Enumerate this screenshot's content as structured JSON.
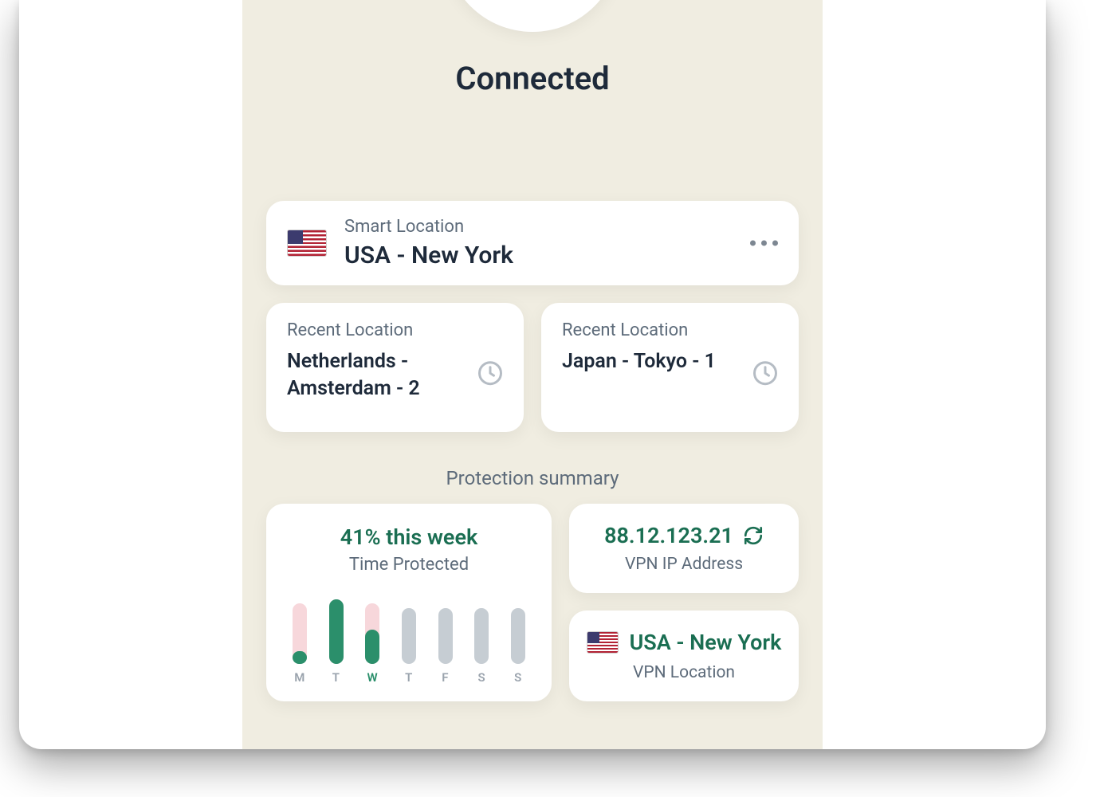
{
  "status": {
    "title": "Connected"
  },
  "smart_location": {
    "label": "Smart Location",
    "value": "USA - New York",
    "flag": "usa"
  },
  "recent": [
    {
      "label": "Recent Location",
      "value": "Netherlands - Amsterdam - 2"
    },
    {
      "label": "Recent Location",
      "value": "Japan - Tokyo - 1"
    }
  ],
  "protection": {
    "section_title": "Protection summary",
    "time": {
      "metric": "41% this week",
      "sub": "Time Protected"
    },
    "ip": {
      "value": "88.12.123.21",
      "label": "VPN IP Address"
    },
    "location": {
      "value": "USA - New York",
      "label": "VPN Location",
      "flag": "usa"
    }
  },
  "chart_data": {
    "type": "bar",
    "title": "Time Protected",
    "categories": [
      "M",
      "T",
      "W",
      "T",
      "F",
      "S",
      "S"
    ],
    "series": [
      {
        "name": "usage_background_pct",
        "values": [
          85,
          90,
          85,
          0,
          0,
          0,
          0
        ],
        "color": "#f7d7db",
        "note": "pink background height as % of track for days with any data"
      },
      {
        "name": "protected_pct",
        "values": [
          18,
          90,
          48,
          0,
          0,
          0,
          0
        ],
        "color": "#2b8f6b",
        "note": "green fill height as % of track"
      }
    ],
    "inactive_track_height_pct": 78,
    "highlight_index": 2,
    "ylim": [
      0,
      100
    ]
  },
  "colors": {
    "accent_green": "#1a6e52",
    "bar_green": "#2b8f6b",
    "bar_pink": "#f7d7db",
    "bar_grey": "#c6cdd3",
    "bg_cream": "#f0ede1"
  }
}
